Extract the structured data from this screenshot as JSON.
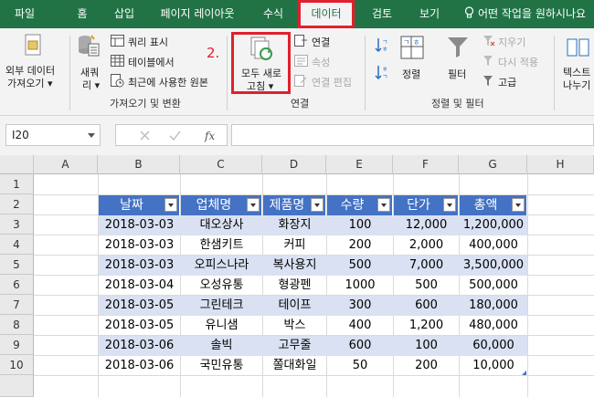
{
  "tabs": [
    {
      "label": "파일",
      "active": false
    },
    {
      "label": "홈",
      "active": false
    },
    {
      "label": "삽입",
      "active": false
    },
    {
      "label": "페이지 레이아웃",
      "active": false
    },
    {
      "label": "수식",
      "active": false
    },
    {
      "label": "데이터",
      "active": true
    },
    {
      "label": "검토",
      "active": false
    },
    {
      "label": "보기",
      "active": false
    }
  ],
  "tell_me": "어떤 작업을 원하시나요",
  "ribbon": {
    "external_data": [
      "외부 데이터",
      "가져오기 ▾"
    ],
    "new_query": [
      "새쿼",
      "리 ▾"
    ],
    "show_queries": "쿼리 표시",
    "from_table": "테이블에서",
    "recent_sources": "최근에 사용한 원본",
    "group_get_transform": "가져오기 및 변환",
    "annotation": "2.",
    "refresh_all": [
      "모두 새로",
      "고침 ▾"
    ],
    "connections": "연결",
    "properties": "속성",
    "edit_links": "연결 편집",
    "group_connections": "연결",
    "sort": "정렬",
    "filter": "필터",
    "clear": "지우기",
    "reapply": "다시 적용",
    "advanced": "고급",
    "group_sort_filter": "정렬 및 필터",
    "text_to_columns": [
      "텍스트",
      "나누기"
    ]
  },
  "name_box": "I20",
  "formula_value": "",
  "columns": [
    "A",
    "B",
    "C",
    "D",
    "E",
    "F",
    "G",
    "H"
  ],
  "rows": [
    "1",
    "2",
    "3",
    "4",
    "5",
    "6",
    "7",
    "8",
    "9",
    "10"
  ],
  "table": {
    "headers": [
      "날짜",
      "업체명",
      "제품명",
      "수량",
      "단가",
      "총액"
    ],
    "rows": [
      [
        "2018-03-03",
        "대오상사",
        "화장지",
        "100",
        "12,000",
        "1,200,000"
      ],
      [
        "2018-03-03",
        "한샘키트",
        "커피",
        "200",
        "2,000",
        "400,000"
      ],
      [
        "2018-03-03",
        "오피스나라",
        "복사용지",
        "500",
        "7,000",
        "3,500,000"
      ],
      [
        "2018-03-04",
        "오성유통",
        "형광펜",
        "1000",
        "500",
        "500,000"
      ],
      [
        "2018-03-05",
        "그린테크",
        "테이프",
        "300",
        "600",
        "180,000"
      ],
      [
        "2018-03-05",
        "유니샘",
        "박스",
        "400",
        "1,200",
        "480,000"
      ],
      [
        "2018-03-06",
        "솔빅",
        "고무줄",
        "600",
        "100",
        "60,000"
      ],
      [
        "2018-03-06",
        "국민유통",
        "쫄대화일",
        "50",
        "200",
        "10,000"
      ]
    ]
  },
  "colors": {
    "excel_green": "#217346",
    "highlight_red": "#e0202e",
    "table_header": "#4472c4",
    "band": "#d9e1f2"
  }
}
